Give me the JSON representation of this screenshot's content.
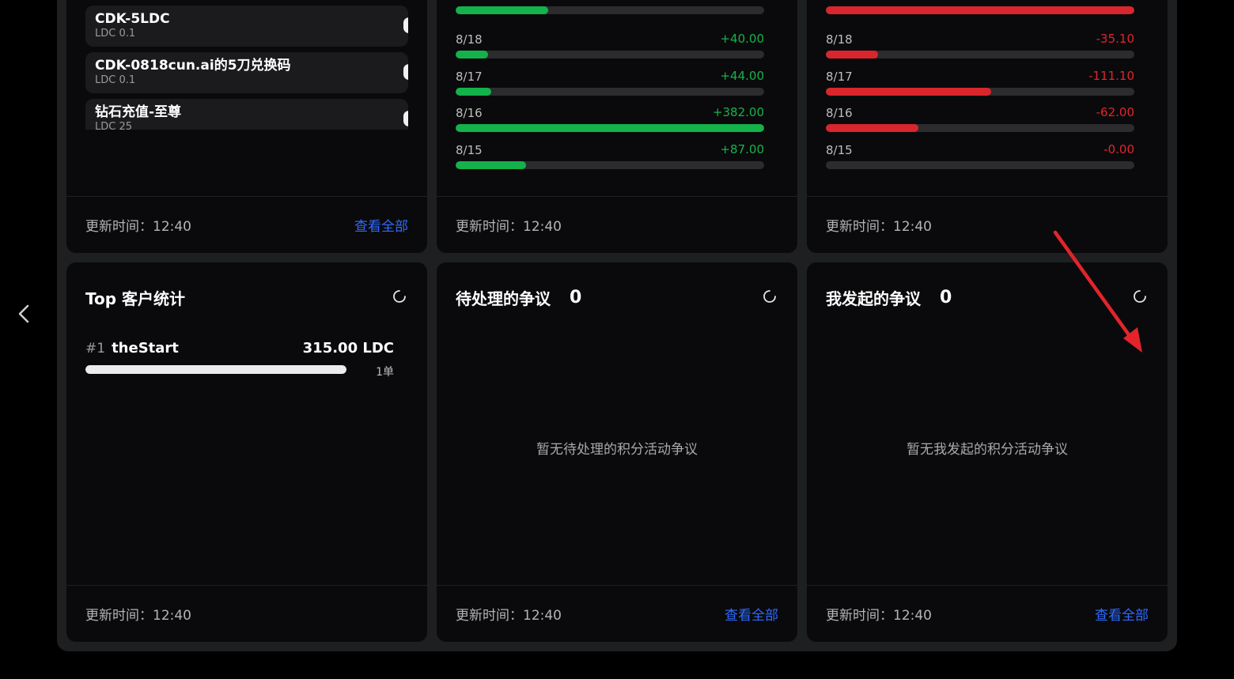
{
  "colors": {
    "green": "#14b24a",
    "red": "#d9262d",
    "link": "#2f6bff"
  },
  "products": [
    {
      "name": "CDK-5LDC",
      "price": "LDC 0.1"
    },
    {
      "name": "CDK-0818cun.ai的5刀兑换码",
      "price": "LDC 0.1"
    },
    {
      "name": "钻石充值-至尊",
      "price": "LDC 25"
    }
  ],
  "income": {
    "top_fill": 0.3,
    "rows": [
      {
        "date": "8/18",
        "value": "+40.00",
        "fraction": 0.105
      },
      {
        "date": "8/17",
        "value": "+44.00",
        "fraction": 0.115
      },
      {
        "date": "8/16",
        "value": "+382.00",
        "fraction": 1.0
      },
      {
        "date": "8/15",
        "value": "+87.00",
        "fraction": 0.228
      }
    ]
  },
  "expense": {
    "top_fill": 1.0,
    "rows": [
      {
        "date": "8/18",
        "value": "-35.10",
        "fraction": 0.17
      },
      {
        "date": "8/17",
        "value": "-111.10",
        "fraction": 0.535
      },
      {
        "date": "8/16",
        "value": "-62.00",
        "fraction": 0.3
      },
      {
        "date": "8/15",
        "value": "-0.00",
        "fraction": 0
      }
    ]
  },
  "footer": {
    "update_label": "更新时间：12:40",
    "view_all": "查看全部"
  },
  "top_customers": {
    "title": "Top 客户统计",
    "items": [
      {
        "rank": "#1",
        "name": "theStart",
        "amount": "315.00 LDC",
        "orders": "1单",
        "fraction": 1.0
      }
    ]
  },
  "pending_disputes": {
    "title": "待处理的争议",
    "count": "0",
    "empty_text": "暂无待处理的积分活动争议"
  },
  "my_disputes": {
    "title": "我发起的争议",
    "count": "0",
    "empty_text": "暂无我发起的积分活动争议"
  },
  "icons": {
    "nav": "chevron-left-icon",
    "refresh": "refresh-icon",
    "annotation": "red-arrow-annotation"
  }
}
